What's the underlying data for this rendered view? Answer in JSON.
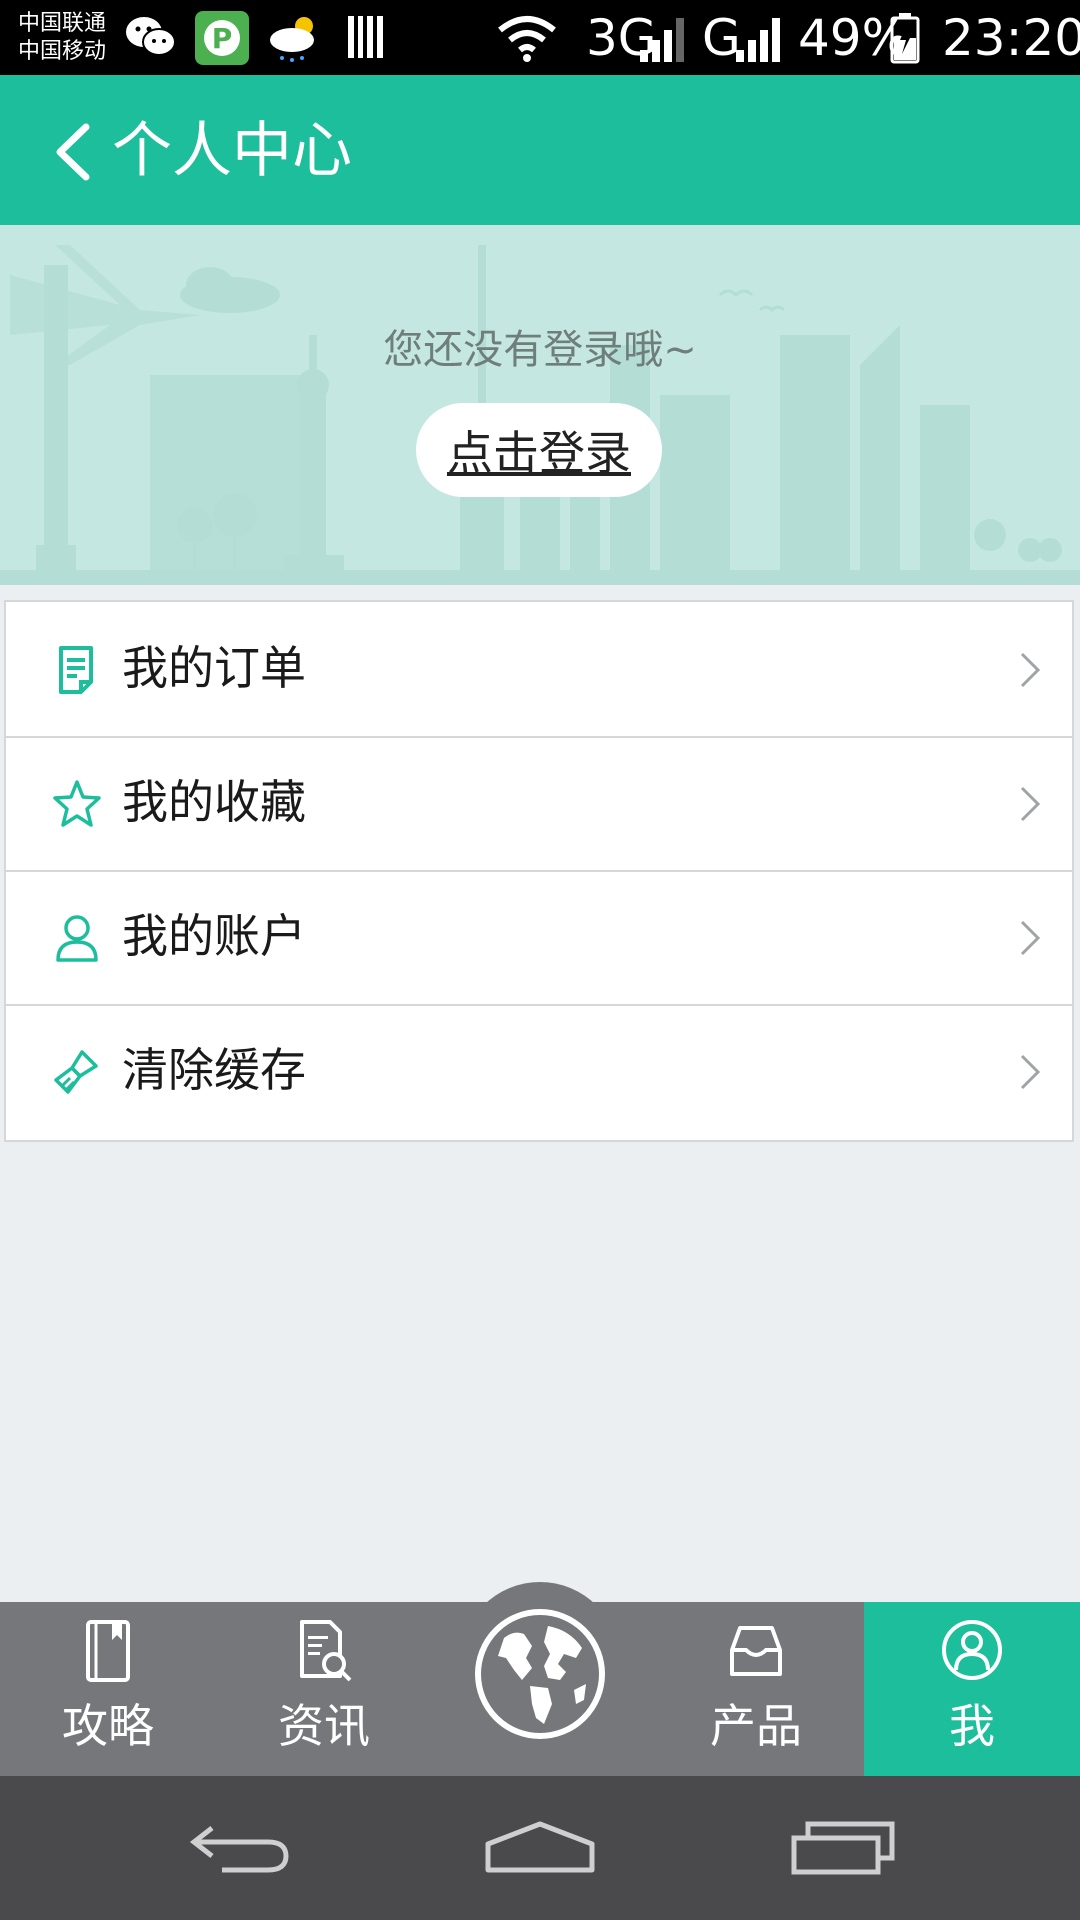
{
  "status_bar": {
    "carrier_1": "中国联通",
    "carrier_2": "中国移动",
    "network_1": "3G",
    "network_2": "G",
    "battery": "49%",
    "time": "23:20",
    "icons": [
      "wechat-icon",
      "parking-app-icon",
      "weather-icon",
      "barcode-icon",
      "wifi-icon",
      "signal-icon",
      "battery-icon"
    ]
  },
  "header": {
    "title": "个人中心",
    "back_icon": "back-arrow-icon"
  },
  "banner": {
    "prompt": "您还没有登录哦~",
    "login_label": "点击登录"
  },
  "menu": {
    "items": [
      {
        "label": "我的订单",
        "icon": "order-document-icon"
      },
      {
        "label": "我的收藏",
        "icon": "star-icon"
      },
      {
        "label": "我的账户",
        "icon": "user-icon"
      },
      {
        "label": "清除缓存",
        "icon": "brush-icon"
      }
    ]
  },
  "tab_bar": {
    "tabs": [
      {
        "label": "攻略",
        "icon": "guide-book-icon"
      },
      {
        "label": "资讯",
        "icon": "news-search-icon"
      },
      {
        "label": "",
        "icon": "globe-icon"
      },
      {
        "label": "产品",
        "icon": "inbox-icon"
      },
      {
        "label": "我",
        "icon": "profile-icon",
        "active": true
      }
    ]
  },
  "nav_bar": {
    "icons": [
      "back-nav-icon",
      "home-nav-icon",
      "recents-nav-icon"
    ]
  },
  "colors": {
    "accent": "#1dbe9c",
    "banner_bg": "#c4e8e1",
    "tab_bar_bg": "#75777b",
    "page_bg": "#ebeff2"
  }
}
